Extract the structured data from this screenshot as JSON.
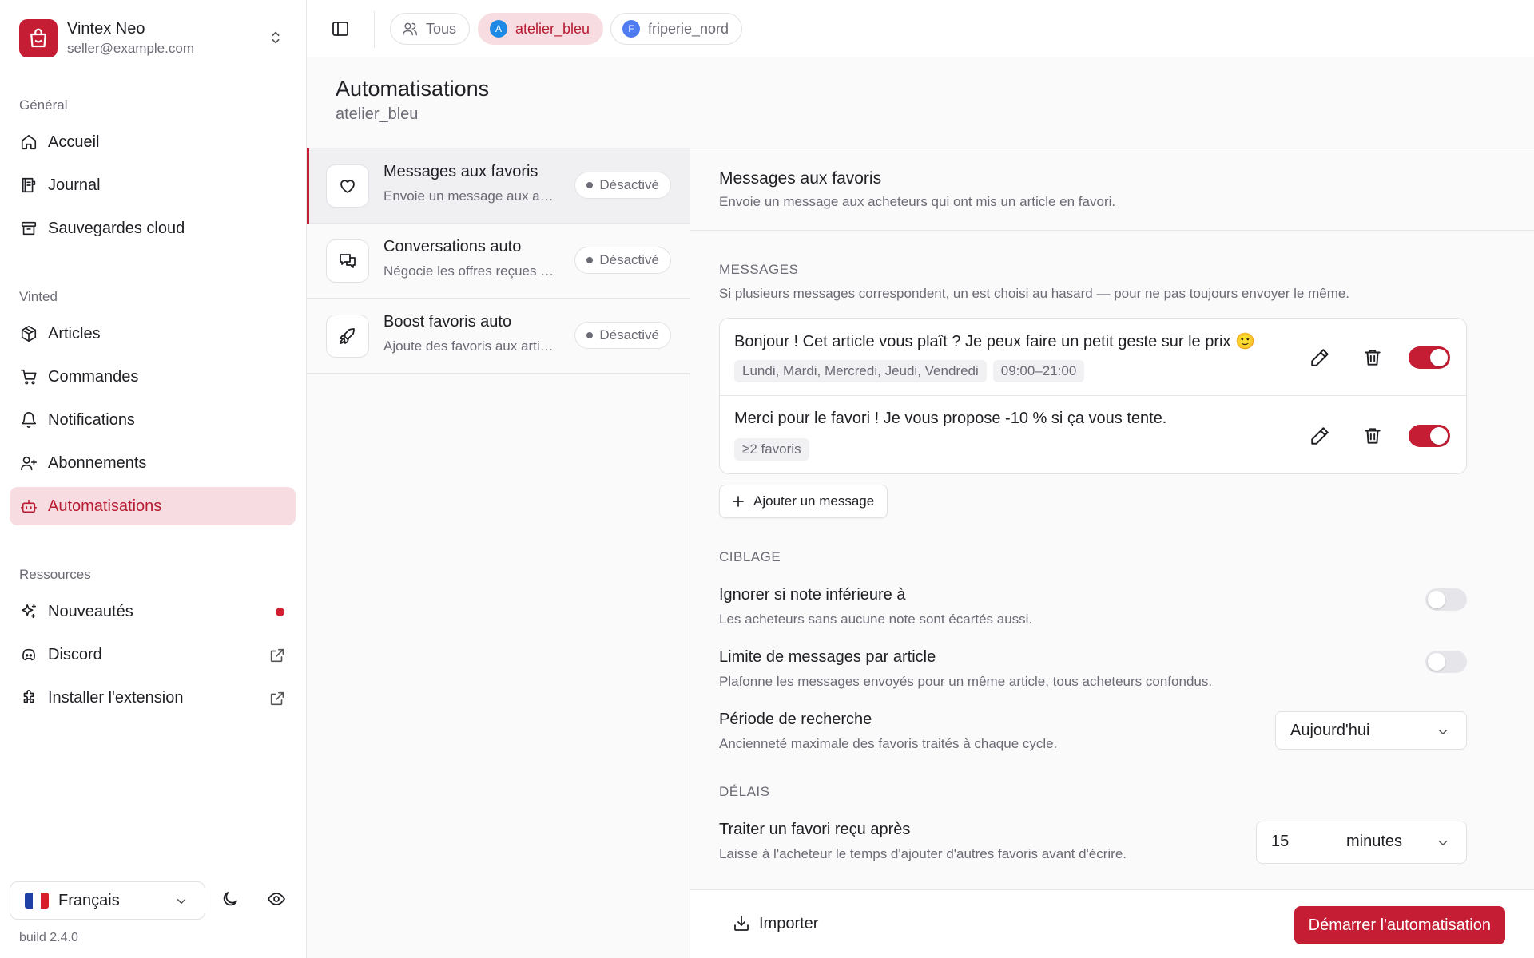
{
  "colors": {
    "accent": "#c51d34",
    "accent_soft": "#f7dde1",
    "text": "#1f1f24",
    "muted": "#6b6b75",
    "border": "#e1e1e6"
  },
  "brand": {
    "name": "Vintex Neo",
    "email": "seller@example.com",
    "logo_icon": "shopping-bag-icon"
  },
  "sidebar": {
    "groups": [
      {
        "label": "Général",
        "items": [
          {
            "label": "Accueil",
            "icon": "home-icon"
          },
          {
            "label": "Journal",
            "icon": "journal-icon"
          },
          {
            "label": "Sauvegardes cloud",
            "icon": "archive-icon"
          }
        ]
      },
      {
        "label": "Vinted",
        "items": [
          {
            "label": "Articles",
            "icon": "package-icon"
          },
          {
            "label": "Commandes",
            "icon": "cart-icon"
          },
          {
            "label": "Notifications",
            "icon": "bell-icon"
          },
          {
            "label": "Abonnements",
            "icon": "user-plus-icon"
          },
          {
            "label": "Automatisations",
            "icon": "bot-icon",
            "active": true
          }
        ]
      },
      {
        "label": "Ressources",
        "items": [
          {
            "label": "Nouveautés",
            "icon": "sparkles-icon",
            "badge": "new-dot"
          },
          {
            "label": "Discord",
            "icon": "discord-icon",
            "trail": "external-link-icon"
          },
          {
            "label": "Installer l'extension",
            "icon": "puzzle-icon",
            "trail": "external-link-icon"
          }
        ]
      }
    ],
    "language": {
      "label": "Français",
      "flag": "fr-flag"
    },
    "build": "build 2.4.0"
  },
  "topbar": {
    "chips": [
      {
        "label": "Tous",
        "icon": "users-icon"
      },
      {
        "label": "atelier_bleu",
        "avatar": "A",
        "avatar_color": "#1e88e5",
        "active": true
      },
      {
        "label": "friperie_nord",
        "avatar": "F",
        "avatar_color": "#4f7cf0"
      }
    ]
  },
  "page": {
    "title": "Automatisations",
    "subtitle": "atelier_bleu"
  },
  "automations": [
    {
      "title": "Messages aux favoris",
      "desc": "Envoie un message aux acheteurs qui ont mis un article en favori.",
      "status": "Désactivé",
      "icon": "heart-icon",
      "selected": true
    },
    {
      "title": "Conversations auto",
      "desc": "Négocie les offres reçues automatiquement.",
      "status": "Désactivé",
      "icon": "chat-icon"
    },
    {
      "title": "Boost favoris auto",
      "desc": "Ajoute des favoris aux articles automatiquement.",
      "status": "Désactivé",
      "icon": "rocket-icon"
    }
  ],
  "detail": {
    "title": "Messages aux favoris",
    "desc": "Envoie un message aux acheteurs qui ont mis un article en favori.",
    "messages_section": {
      "label": "MESSAGES",
      "help": "Si plusieurs messages correspondent, un est choisi au hasard — pour ne pas toujours envoyer le même.",
      "items": [
        {
          "text": "Bonjour ! Cet article vous plaît ? Je peux faire un petit geste sur le prix 🙂",
          "tags": [
            "Lundi, Mardi, Mercredi, Jeudi, Vendredi",
            "09:00–21:00"
          ],
          "enabled": true
        },
        {
          "text": "Merci pour le favori ! Je vous propose -10 % si ça vous tente.",
          "tags": [
            "≥2 favoris"
          ],
          "enabled": true
        }
      ],
      "add_label": "Ajouter un message"
    },
    "targeting": {
      "label": "CIBLAGE",
      "settings": [
        {
          "title": "Ignorer si note inférieure à",
          "desc": "Les acheteurs sans aucune note sont écartés aussi.",
          "enabled": false
        },
        {
          "title": "Limite de messages par article",
          "desc": "Plafonne les messages envoyés pour un même article, tous acheteurs confondus.",
          "enabled": false
        },
        {
          "title": "Période de recherche",
          "desc": "Ancienneté maximale des favoris traités à chaque cycle.",
          "value": "Aujourd'hui"
        }
      ]
    },
    "delays": {
      "label": "DÉLAIS",
      "settings": [
        {
          "title": "Traiter un favori reçu après",
          "desc": "Laisse à l'acheteur le temps d'ajouter d'autres favoris avant d'écrire.",
          "amount": "15",
          "unit": "minutes"
        }
      ]
    }
  },
  "footer": {
    "import_label": "Importer",
    "start_label": "Démarrer l'automatisation"
  }
}
